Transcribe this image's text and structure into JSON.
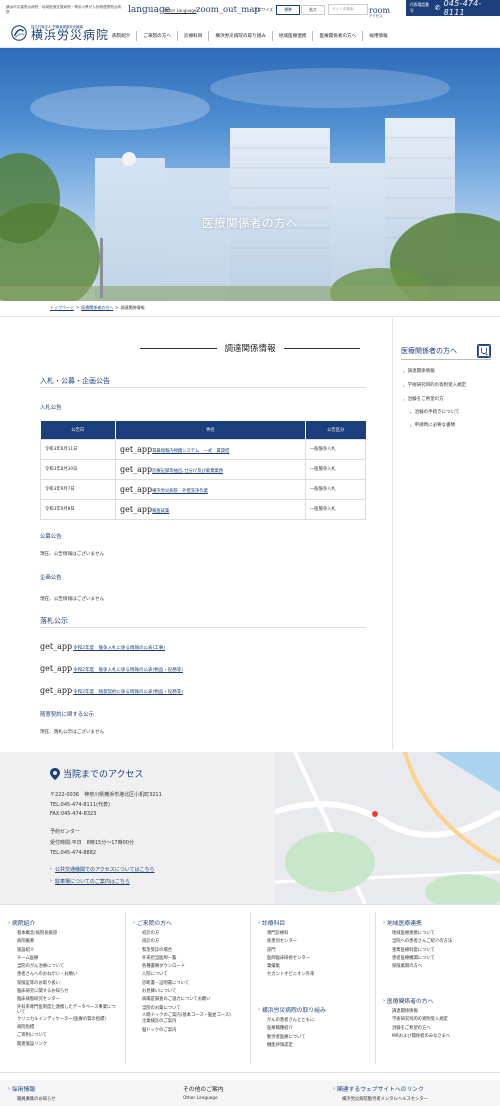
{
  "header": {
    "tagline": "横浜市災害拠点病院・地域医療支援病院・神奈川県がん診療連携拠点病院",
    "logo_sub": "独立行政法人 労働者健康安全機構",
    "logo_name": "横浜労災病院",
    "language_icon": "language",
    "language_label": "Other Language",
    "zoom_icon": "zoom_out_map",
    "font_size_label": "文字サイズ",
    "font_std": "標準",
    "font_large": "拡大",
    "search_placeholder": "サイト内検索",
    "room_icon": "room",
    "room_label": "アクセス",
    "phone_label": "代表電話番号",
    "phone_number": "045-474-8111"
  },
  "nav": [
    "病院紹介",
    "ご来院の方へ",
    "診療科目",
    "横浜労災病院の取り組み",
    "地域医療連携",
    "医療関係者の方へ",
    "採用情報"
  ],
  "hero": {
    "title": "医療関係者の方へ"
  },
  "breadcrumb": [
    "トップページ",
    "医療関係者の方へ",
    "調達関係情報"
  ],
  "main": {
    "heading": "調達関係情報",
    "bid_section": "入札・公募・企画公告",
    "bid_sub": "入札公告",
    "table": {
      "headers": [
        "公告日",
        "件名",
        "公告区分"
      ],
      "icon_text": "get_app",
      "rows": [
        [
          "令和3年8月11日",
          "耳鼻咽喉内視鏡システム　一式　賃貸借",
          "一般競争入札"
        ],
        [
          "令和3年8月30日",
          "診療記録等抽出､仕分け及び廃棄業務",
          "一般競争入札"
        ],
        [
          "令和3年9月7日",
          "横浜労災病院　外壁洗浄作業",
          "一般競争入札"
        ],
        [
          "令和3年9月8日",
          "検査試薬",
          "一般競争入札"
        ]
      ]
    },
    "public_sub": "公募公告",
    "public_text": "現在、公告情報はございません",
    "plan_sub": "企画公告",
    "plan_text": "現在、公告情報はございません",
    "award_section": "落札公示",
    "awards": [
      "令和2年度　競争入札に係る情報の公表(工事)",
      "令和2年度　競争入札に係る情報の公表(物品・役務等)",
      "令和2年度　随意契約に係る情報の公表(物品・役務等)"
    ],
    "voluntary_sub": "随意契約に関する公示",
    "voluntary_text": "現在、落札公示はございません"
  },
  "sidebar": {
    "title": "医療関係者の方へ",
    "items": [
      "調達関係情報",
      "学術研究目的の寄附受入規定",
      "治験をご希望の方"
    ],
    "sub_items": [
      "治験の手続きについて",
      "申請時に必要な書類"
    ]
  },
  "access": {
    "title": "当院までのアクセス",
    "address": "〒222-0036　神奈川県横浜市港北区小机町3211",
    "tel": "TEL:045-474-8111(代表)",
    "fax": "FAX:045-474-8323",
    "reserve_label": "予約センター",
    "reserve_hours": "受付時間:平日　8時15分〜17時00分",
    "reserve_tel": "TEL:045-474-8882",
    "link1": "公共交通機関でのアクセスについてはこちら",
    "link2": "駐車場についてのご案内はこちら"
  },
  "footer": {
    "col1": {
      "title": "病院紹介",
      "items": [
        "基本概念/病院長挨拶",
        "病院概要",
        "施設紹介",
        "チーム医療",
        "当院のがん治療について",
        "患者さんへのおねがい・お願い",
        "保険証等のお取り扱い",
        "臨床研究に関するお知らせ",
        "臨床病態研究センター",
        "外科系専門医制度と連携したデータベース事業について",
        "クリニカルインディケーター(医療の質の指標)",
        "病院指標",
        "ご寄附について",
        "関連施設リンク"
      ]
    },
    "col2": {
      "title": "ご来院の方へ",
      "items": [
        "初診の方",
        "再診の方",
        "緊急受診の場合",
        "外来担当医師一覧",
        "各種書類ダウンロード",
        "入院について",
        "診断書・証明書について",
        "お見舞いについて",
        "病職是調査のご協力についてお願い",
        "当院のお薬について",
        "人間ドックのご案内(基本コース・脳並コース)",
        "企業検診のご案内",
        "脳ドックのご案内"
      ]
    },
    "col3": {
      "title": "診療科目",
      "items": [
        "専門診療科",
        "疾患別センター",
        "部門",
        "医師臨床研修センター",
        "業績集",
        "セカンドオピニオン外来"
      ]
    },
    "col3b": {
      "title": "横浜労災病院の取り組み",
      "items": [
        "がんの患者さんとともに",
        "医療職種紹介",
        "勤労者医療について",
        "機能評価認定"
      ]
    },
    "col4": {
      "title": "地域医療連携",
      "items": [
        "地域医療連携について",
        "当院への患者さんご紹介の方法",
        "重篤医療制度について",
        "患者医療機関について",
        "保険業期の方へ"
      ]
    },
    "col4b": {
      "title": "医療関係者の方へ",
      "items": [
        "調達関係情報",
        "学術研究目的の寄附受入規定",
        "治験をご希望の方へ",
        "MRおよび関係者のみなさまへ"
      ]
    },
    "bottom": {
      "recruit_title": "採用情報",
      "recruit_item": "職員募集のお知らせ",
      "other_title": "その他のご案内",
      "other_item": "Other Language",
      "related_title": "関連するウェブサイトへのリンク",
      "related_item": "横浜労災病院勤労者メンタルヘルスセンター"
    }
  },
  "colors": {
    "brand": "#1a3f7a",
    "access_bg": "#f0f0f0"
  },
  "icons": [
    "logo-mark-icon",
    "phone-icon",
    "language-icon",
    "zoom-out-map-icon",
    "room-icon",
    "pin-icon",
    "chevron-right-icon",
    "download-icon"
  ]
}
